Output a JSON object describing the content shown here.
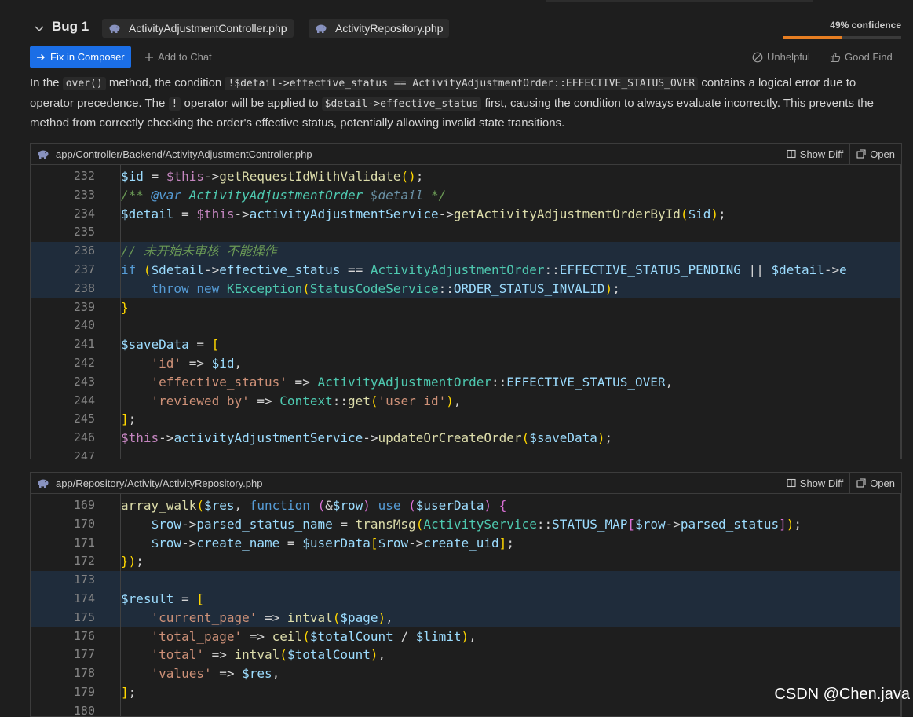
{
  "bug": {
    "title": "Bug 1",
    "files": [
      "ActivityAdjustmentController.php",
      "ActivityRepository.php"
    ],
    "confidence_text": "49% confidence",
    "confidence": 0.49
  },
  "actions": {
    "fix": "Fix in Composer",
    "add_chat": "Add to Chat",
    "unhelpful": "Unhelpful",
    "good_find": "Good Find"
  },
  "description": {
    "t1": "In the ",
    "c1": "over()",
    "t2": " method, the condition ",
    "c2": "!$detail->effective_status == ActivityAdjustmentOrder::EFFECTIVE_STATUS_OVER",
    "t3": " contains a logical error due to operator precedence. The ",
    "c3": "!",
    "t4": " operator will be applied to ",
    "c4": "$detail->effective_status",
    "t5": " first, causing the condition to always evaluate incorrectly. This prevents the method from correctly checking the order's effective status, potentially allowing invalid state transitions."
  },
  "panels": [
    {
      "path": "app/Controller/Backend/ActivityAdjustmentController.php",
      "show_diff": "Show Diff",
      "open": "Open",
      "lines": [
        {
          "n": "232",
          "t": "        $id = $this->getRequestIdWithValidate();"
        },
        {
          "n": "233",
          "t": "        /** @var ActivityAdjustmentOrder $detail */"
        },
        {
          "n": "234",
          "t": "        $detail = $this->activityAdjustmentService->getActivityAdjustmentOrderById($id);"
        },
        {
          "n": "235",
          "t": ""
        },
        {
          "n": "236",
          "t": "        // 未开始未审核 不能操作"
        },
        {
          "n": "237",
          "t": "        if ($detail->effective_status == ActivityAdjustmentOrder::EFFECTIVE_STATUS_PENDING || $detail->e"
        },
        {
          "n": "238",
          "t": "            throw new KException(StatusCodeService::ORDER_STATUS_INVALID);"
        },
        {
          "n": "239",
          "t": "        }"
        },
        {
          "n": "240",
          "t": ""
        },
        {
          "n": "241",
          "t": "        $saveData = ["
        },
        {
          "n": "242",
          "t": "            'id' => $id,"
        },
        {
          "n": "243",
          "t": "            'effective_status' => ActivityAdjustmentOrder::EFFECTIVE_STATUS_OVER,"
        },
        {
          "n": "244",
          "t": "            'reviewed_by' => Context::get('user_id'),"
        },
        {
          "n": "245",
          "t": "        ];"
        },
        {
          "n": "246",
          "t": "        $this->activityAdjustmentService->updateOrCreateOrder($saveData);"
        },
        {
          "n": "247",
          "t": ""
        }
      ]
    },
    {
      "path": "app/Repository/Activity/ActivityRepository.php",
      "show_diff": "Show Diff",
      "open": "Open",
      "lines": [
        {
          "n": "169",
          "t": "        array_walk($res, function (&$row) use ($userData) {"
        },
        {
          "n": "170",
          "t": "            $row->parsed_status_name = transMsg(ActivityService::STATUS_MAP[$row->parsed_status]);"
        },
        {
          "n": "171",
          "t": "            $row->create_name = $userData[$row->create_uid];"
        },
        {
          "n": "172",
          "t": "        });"
        },
        {
          "n": "173",
          "t": ""
        },
        {
          "n": "174",
          "t": "        $result = ["
        },
        {
          "n": "175",
          "t": "            'current_page' => intval($page),"
        },
        {
          "n": "176",
          "t": "            'total_page' => ceil($totalCount / $limit),"
        },
        {
          "n": "177",
          "t": "            'total' => intval($totalCount),"
        },
        {
          "n": "178",
          "t": "            'values' => $res,"
        },
        {
          "n": "179",
          "t": "        ];"
        },
        {
          "n": "180",
          "t": ""
        }
      ]
    }
  ],
  "watermark": "CSDN @Chen.java",
  "colors": {
    "accent": "#1b6ee6",
    "confidence": "#e67e22",
    "highlight": "#1f2c3b"
  }
}
